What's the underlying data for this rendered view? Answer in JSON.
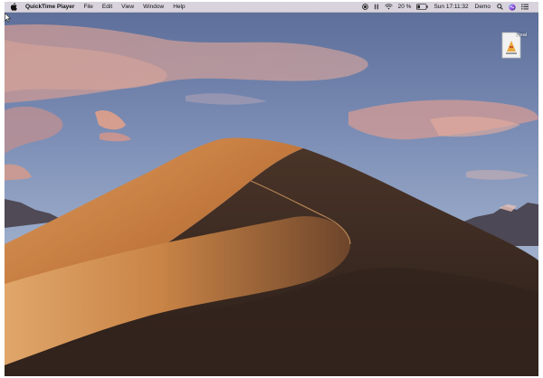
{
  "menubar": {
    "app_name": "QuickTime Player",
    "items": [
      "File",
      "Edit",
      "View",
      "Window",
      "Help"
    ],
    "status": {
      "battery_percent": "20 %",
      "clock": "Sun 17:11:32",
      "user": "Demo"
    },
    "icons": [
      "apple-icon",
      "screen-record-icon",
      "pause-icon",
      "wifi-icon",
      "battery-icon",
      "spotlight-icon",
      "siri-icon",
      "notification-center-icon"
    ]
  },
  "desktop": {
    "wallpaper": "desert-dune",
    "icons": [
      {
        "label": "KeySteal",
        "icon": "app-installer-document-icon"
      }
    ]
  },
  "colors": {
    "menubar_bg": "#e2dee8",
    "sky_top": "#6a7fa8",
    "cloud_pink": "#d99a8c",
    "dune_light": "#d08a4c",
    "dune_shadow": "#3b2a22"
  }
}
